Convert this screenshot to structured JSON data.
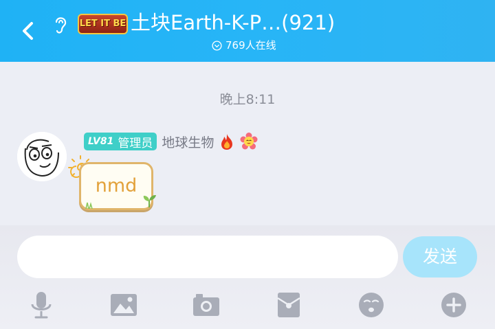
{
  "header": {
    "badge_text": "LET IT BE",
    "title": "土块Earth-K-P…(921)",
    "online": "769人在线",
    "icons": {
      "back": "back-arrow-icon",
      "ear": "ear-icon",
      "chevron": "chevron-down-circle-icon"
    }
  },
  "chat": {
    "timestamp": "晚上8:11",
    "message": {
      "level": "LV81",
      "role": "管理员",
      "sender": "地球生物",
      "text": "nmd",
      "icons": [
        "fire-icon",
        "smiling-flower-icon"
      ]
    }
  },
  "composer": {
    "placeholder": "",
    "send_label": "发送",
    "tools": [
      "microphone-icon",
      "image-icon",
      "camera-icon",
      "red-packet-icon",
      "emoji-icon",
      "plus-icon"
    ]
  },
  "colors": {
    "header": "#27b5f7",
    "background": "#eceef5",
    "send_button": "#a7e4fb",
    "level_badge": "#3fcfc8",
    "bubble_text": "#e2a13a"
  }
}
